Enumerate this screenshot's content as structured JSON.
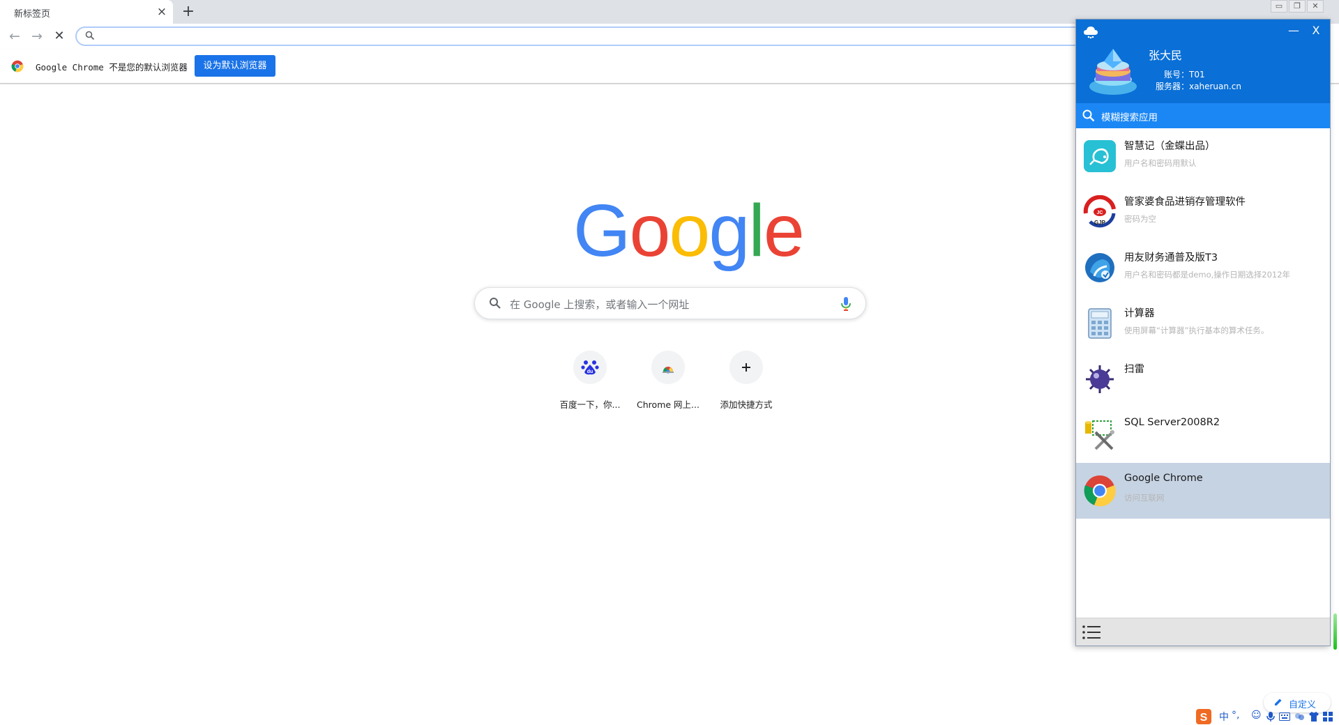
{
  "browser": {
    "tab_title": "新标签页",
    "tab_close": "×",
    "new_tab": "+",
    "omnibox_value": "",
    "infobar_text": "Google Chrome 不是您的默认浏览器",
    "infobar_button": "设为默认浏览器"
  },
  "ntp": {
    "logo_letters": [
      "G",
      "o",
      "o",
      "g",
      "l",
      "e"
    ],
    "search_placeholder": "在 Google 上搜索，或者输入一个网址",
    "shortcuts": [
      {
        "label": "百度一下，你..."
      },
      {
        "label": "Chrome 网上..."
      },
      {
        "label": "添加快捷方式"
      }
    ],
    "customize_label": "自定义"
  },
  "launcher": {
    "user_name": "张大民",
    "account_label": "账号：",
    "account_value": "T01",
    "server_label": "服务器：",
    "server_value": "xaheruan.cn",
    "minimize": "—",
    "close": "X",
    "search_placeholder": "模糊搜索应用",
    "apps": [
      {
        "name": "智慧记（金蝶出品）",
        "desc": "用户名和密码用默认"
      },
      {
        "name": "管家婆食品进销存管理软件",
        "desc": "密码为空"
      },
      {
        "name": "用友财务通普及版T3",
        "desc": "用户名和密码都是demo,操作日期选择2012年"
      },
      {
        "name": "计算器",
        "desc": "使用屏幕“计算器”执行基本的算术任务。"
      },
      {
        "name": "扫雷",
        "desc": ""
      },
      {
        "name": "SQL Server2008R2",
        "desc": ""
      },
      {
        "name": "Google Chrome",
        "desc": "访问互联网"
      }
    ]
  },
  "ime": {
    "mode": "中",
    "punct": "°,"
  },
  "colors": {
    "google_blue": "#4285f4",
    "google_red": "#ea4335",
    "google_yellow": "#fbbc05",
    "google_green": "#34a853",
    "panel_header": "#0a6fd6",
    "panel_search": "#1b87f5",
    "selected_row": "#c6d3e3"
  }
}
